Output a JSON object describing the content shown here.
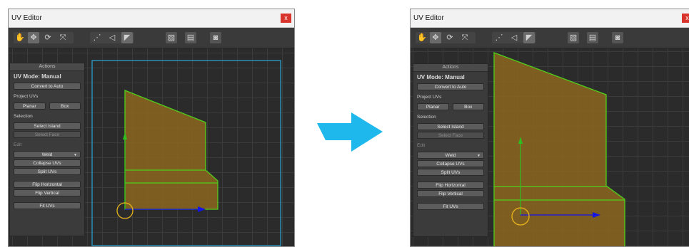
{
  "windows": [
    {
      "id": "before",
      "title": "UV Editor",
      "close_label": "x",
      "actions_header": "Actions",
      "uv_mode": "UV Mode: Manual",
      "convert_label": "Convert to Auto",
      "project_uvs_label": "Project UVs",
      "planar_label": "Planar",
      "box_label": "Box",
      "selection_label": "Selection",
      "select_island_label": "Select Island",
      "select_face_label": "Select Face",
      "edit_label": "Edit",
      "weld_label": "Weld",
      "collapse_uvs_label": "Collapse UVs",
      "split_uvs_label": "Split UVs",
      "flip_horizontal_label": "Flip Horizontal",
      "flip_vertical_label": "Flip Vertical",
      "fit_uvs_label": "Fit UVs"
    },
    {
      "id": "after",
      "title": "UV Editor",
      "close_label": "x",
      "actions_header": "Actions",
      "uv_mode": "UV Mode: Manual",
      "convert_label": "Convert to Auto",
      "project_uvs_label": "Project UVs",
      "planar_label": "Planar",
      "box_label": "Box",
      "selection_label": "Selection",
      "select_island_label": "Select Island",
      "select_face_label": "Select Face",
      "edit_label": "Edit",
      "weld_label": "Weld",
      "collapse_uvs_label": "Collapse UVs",
      "split_uvs_label": "Split UVs",
      "flip_horizontal_label": "Flip Horizontal",
      "flip_vertical_label": "Flip Vertical",
      "fit_uvs_label": "Fit UVs"
    }
  ],
  "toolbar_icons": [
    "hand-icon",
    "move-icon",
    "rotate-icon",
    "scale-icon",
    "vertex-icon",
    "edge-icon",
    "face-icon",
    "texture-icon",
    "preferences-icon",
    "camera-icon"
  ],
  "colors": {
    "uv_fill": "#8a6420",
    "uv_edge": "#4fd11a",
    "canvas_bound": "#2aa7d8",
    "handle_x": "#1414e6",
    "handle_y": "#2fbf1f",
    "pivot": "#e8b41a",
    "transition_arrow": "#1fb8ec"
  }
}
